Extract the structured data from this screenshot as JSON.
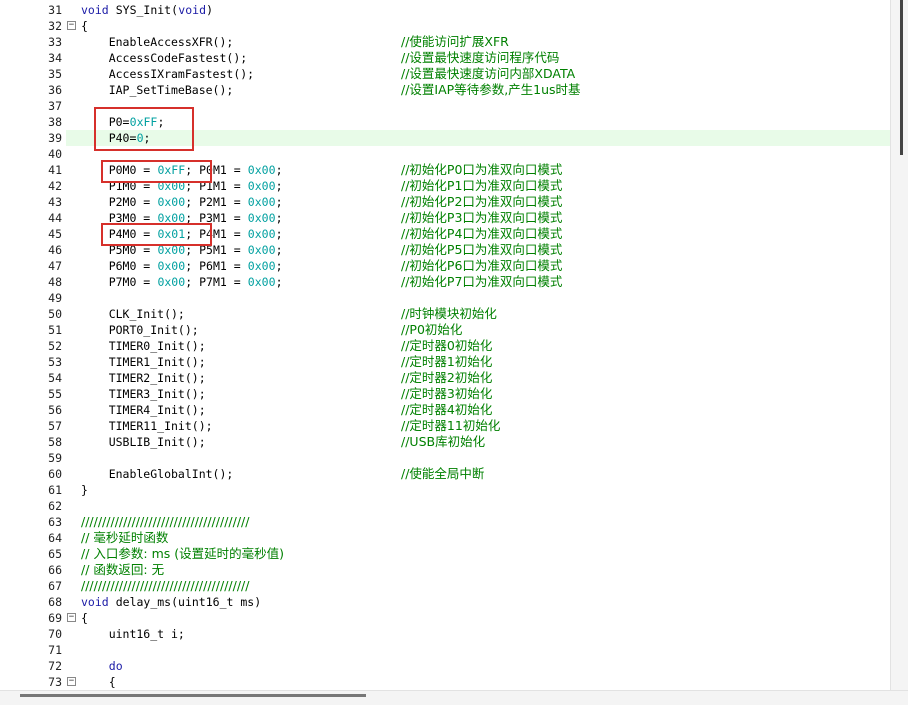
{
  "editor": {
    "lines": [
      {
        "num": "31",
        "fold": "",
        "segs": [
          {
            "t": "void",
            "c": "kw"
          },
          {
            "t": " SYS_Init(",
            "c": ""
          },
          {
            "t": "void",
            "c": "kw"
          },
          {
            "t": ")",
            "c": ""
          }
        ]
      },
      {
        "num": "32",
        "fold": "-",
        "segs": [
          {
            "t": "{",
            "c": ""
          }
        ]
      },
      {
        "num": "33",
        "fold": "",
        "segs": [
          {
            "t": "    EnableAccessXFR();",
            "c": ""
          }
        ],
        "comment": "//使能访问扩展XFR"
      },
      {
        "num": "34",
        "fold": "",
        "segs": [
          {
            "t": "    AccessCodeFastest();",
            "c": ""
          }
        ],
        "comment": "//设置最快速度访问程序代码"
      },
      {
        "num": "35",
        "fold": "",
        "segs": [
          {
            "t": "    AccessIXramFastest();",
            "c": ""
          }
        ],
        "comment": "//设置最快速度访问内部XDATA"
      },
      {
        "num": "36",
        "fold": "",
        "segs": [
          {
            "t": "    IAP_SetTimeBase();",
            "c": ""
          }
        ],
        "comment": "//设置IAP等待参数,产生1us时基"
      },
      {
        "num": "37",
        "fold": "",
        "segs": []
      },
      {
        "num": "38",
        "fold": "",
        "segs": [
          {
            "t": "    P0=",
            "c": ""
          },
          {
            "t": "0xFF",
            "c": "num"
          },
          {
            "t": ";",
            "c": ""
          }
        ]
      },
      {
        "num": "39",
        "fold": "",
        "cur": true,
        "segs": [
          {
            "t": "    P40=",
            "c": ""
          },
          {
            "t": "0",
            "c": "num"
          },
          {
            "t": ";",
            "c": ""
          }
        ]
      },
      {
        "num": "40",
        "fold": "",
        "segs": []
      },
      {
        "num": "41",
        "fold": "",
        "segs": [
          {
            "t": "    P0M0 = ",
            "c": ""
          },
          {
            "t": "0xFF",
            "c": "num"
          },
          {
            "t": "; P0M1 = ",
            "c": ""
          },
          {
            "t": "0x00",
            "c": "num"
          },
          {
            "t": ";",
            "c": ""
          }
        ],
        "comment": "//初始化P0口为准双向口模式"
      },
      {
        "num": "42",
        "fold": "",
        "segs": [
          {
            "t": "    P1M0 = ",
            "c": ""
          },
          {
            "t": "0x00",
            "c": "num"
          },
          {
            "t": "; P1M1 = ",
            "c": ""
          },
          {
            "t": "0x00",
            "c": "num"
          },
          {
            "t": ";",
            "c": ""
          }
        ],
        "comment": "//初始化P1口为准双向口模式"
      },
      {
        "num": "43",
        "fold": "",
        "segs": [
          {
            "t": "    P2M0 = ",
            "c": ""
          },
          {
            "t": "0x00",
            "c": "num"
          },
          {
            "t": "; P2M1 = ",
            "c": ""
          },
          {
            "t": "0x00",
            "c": "num"
          },
          {
            "t": ";",
            "c": ""
          }
        ],
        "comment": "//初始化P2口为准双向口模式"
      },
      {
        "num": "44",
        "fold": "",
        "segs": [
          {
            "t": "    P3M0 = ",
            "c": ""
          },
          {
            "t": "0x00",
            "c": "num"
          },
          {
            "t": "; P3M1 = ",
            "c": ""
          },
          {
            "t": "0x00",
            "c": "num"
          },
          {
            "t": ";",
            "c": ""
          }
        ],
        "comment": "//初始化P3口为准双向口模式"
      },
      {
        "num": "45",
        "fold": "",
        "segs": [
          {
            "t": "    P4M0 = ",
            "c": ""
          },
          {
            "t": "0x01",
            "c": "num"
          },
          {
            "t": "; P4M1 = ",
            "c": ""
          },
          {
            "t": "0x00",
            "c": "num"
          },
          {
            "t": ";",
            "c": ""
          }
        ],
        "comment": "//初始化P4口为准双向口模式"
      },
      {
        "num": "46",
        "fold": "",
        "segs": [
          {
            "t": "    P5M0 = ",
            "c": ""
          },
          {
            "t": "0x00",
            "c": "num"
          },
          {
            "t": "; P5M1 = ",
            "c": ""
          },
          {
            "t": "0x00",
            "c": "num"
          },
          {
            "t": ";",
            "c": ""
          }
        ],
        "comment": "//初始化P5口为准双向口模式"
      },
      {
        "num": "47",
        "fold": "",
        "segs": [
          {
            "t": "    P6M0 = ",
            "c": ""
          },
          {
            "t": "0x00",
            "c": "num"
          },
          {
            "t": "; P6M1 = ",
            "c": ""
          },
          {
            "t": "0x00",
            "c": "num"
          },
          {
            "t": ";",
            "c": ""
          }
        ],
        "comment": "//初始化P6口为准双向口模式"
      },
      {
        "num": "48",
        "fold": "",
        "segs": [
          {
            "t": "    P7M0 = ",
            "c": ""
          },
          {
            "t": "0x00",
            "c": "num"
          },
          {
            "t": "; P7M1 = ",
            "c": ""
          },
          {
            "t": "0x00",
            "c": "num"
          },
          {
            "t": ";",
            "c": ""
          }
        ],
        "comment": "//初始化P7口为准双向口模式"
      },
      {
        "num": "49",
        "fold": "",
        "segs": []
      },
      {
        "num": "50",
        "fold": "",
        "segs": [
          {
            "t": "    CLK_Init();",
            "c": ""
          }
        ],
        "comment": "//时钟模块初始化"
      },
      {
        "num": "51",
        "fold": "",
        "segs": [
          {
            "t": "    PORT0_Init();",
            "c": ""
          }
        ],
        "comment": "//P0初始化"
      },
      {
        "num": "52",
        "fold": "",
        "segs": [
          {
            "t": "    TIMER0_Init();",
            "c": ""
          }
        ],
        "comment": "//定时器0初始化"
      },
      {
        "num": "53",
        "fold": "",
        "segs": [
          {
            "t": "    TIMER1_Init();",
            "c": ""
          }
        ],
        "comment": "//定时器1初始化"
      },
      {
        "num": "54",
        "fold": "",
        "segs": [
          {
            "t": "    TIMER2_Init();",
            "c": ""
          }
        ],
        "comment": "//定时器2初始化"
      },
      {
        "num": "55",
        "fold": "",
        "segs": [
          {
            "t": "    TIMER3_Init();",
            "c": ""
          }
        ],
        "comment": "//定时器3初始化"
      },
      {
        "num": "56",
        "fold": "",
        "segs": [
          {
            "t": "    TIMER4_Init();",
            "c": ""
          }
        ],
        "comment": "//定时器4初始化"
      },
      {
        "num": "57",
        "fold": "",
        "segs": [
          {
            "t": "    TIMER11_Init();",
            "c": ""
          }
        ],
        "comment": "//定时器11初始化"
      },
      {
        "num": "58",
        "fold": "",
        "segs": [
          {
            "t": "    USBLIB_Init();",
            "c": ""
          }
        ],
        "comment": "//USB库初始化"
      },
      {
        "num": "59",
        "fold": "",
        "segs": []
      },
      {
        "num": "60",
        "fold": "",
        "segs": [
          {
            "t": "    EnableGlobalInt();",
            "c": ""
          }
        ],
        "comment": "//使能全局中断"
      },
      {
        "num": "61",
        "fold": "",
        "segs": [
          {
            "t": "}",
            "c": ""
          }
        ]
      },
      {
        "num": "62",
        "fold": "",
        "segs": []
      },
      {
        "num": "63",
        "fold": "",
        "fullcomment": "////////////////////////////////////////"
      },
      {
        "num": "64",
        "fold": "",
        "fullcomment": "// 毫秒延时函数"
      },
      {
        "num": "65",
        "fold": "",
        "fullcomment": "// 入口参数: ms (设置延时的毫秒值)"
      },
      {
        "num": "66",
        "fold": "",
        "fullcomment": "// 函数返回: 无"
      },
      {
        "num": "67",
        "fold": "",
        "fullcomment": "////////////////////////////////////////"
      },
      {
        "num": "68",
        "fold": "",
        "segs": [
          {
            "t": "void",
            "c": "kw"
          },
          {
            "t": " delay_ms(uint16_t ms)",
            "c": ""
          }
        ]
      },
      {
        "num": "69",
        "fold": "-",
        "segs": [
          {
            "t": "{",
            "c": ""
          }
        ]
      },
      {
        "num": "70",
        "fold": "",
        "segs": [
          {
            "t": "    uint16_t i;",
            "c": ""
          }
        ]
      },
      {
        "num": "71",
        "fold": "",
        "segs": []
      },
      {
        "num": "72",
        "fold": "",
        "segs": [
          {
            "t": "    ",
            "c": ""
          },
          {
            "t": "do",
            "c": "kw"
          }
        ]
      },
      {
        "num": "73",
        "fold": "-",
        "segs": [
          {
            "t": "    {",
            "c": ""
          }
        ]
      }
    ],
    "highlight_boxes": [
      "box-p0-p40",
      "box-p0m0",
      "box-p4m0"
    ]
  }
}
